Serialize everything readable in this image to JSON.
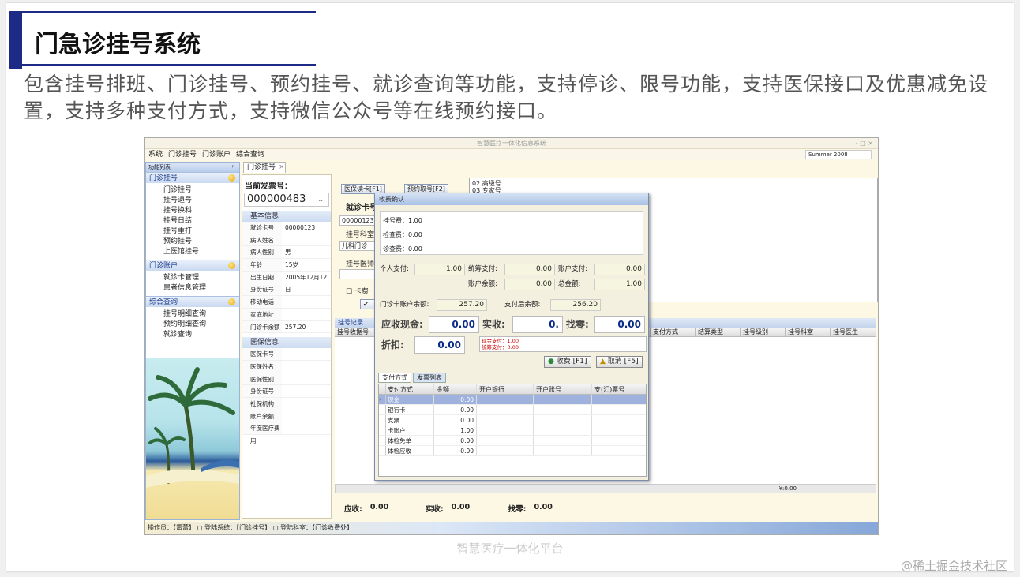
{
  "slide": {
    "title": "门急诊挂号系统",
    "description": "包含挂号排班、门诊挂号、预约挂号、就诊查询等功能，支持停诊、限号功能，支持医保接口及优惠减免设置，支持多种支付方式，支持微信公众号等在线预约接口。",
    "caption": "智慧医疗一体化平台",
    "watermark": "@稀土掘金技术社区"
  },
  "app": {
    "window_title": "智慧医疗一体化信息系统",
    "window_controls": "- □ ×",
    "menu": [
      "系统",
      "门诊挂号",
      "门诊账户",
      "综合查询"
    ],
    "theme": "Summer 2008",
    "function_list_title": "功能列表",
    "pin": "ᵖ",
    "groups": [
      {
        "title": "门诊挂号",
        "items": [
          "门诊挂号",
          "挂号退号",
          "挂号换科",
          "挂号日结",
          "挂号重打",
          "预约挂号",
          "上医馆挂号"
        ]
      },
      {
        "title": "门诊账户",
        "items": [
          "就诊卡管理",
          "患者信息管理"
        ]
      },
      {
        "title": "综合查询",
        "items": [
          "挂号明细查询",
          "预约明细查询",
          "就诊查询"
        ]
      }
    ],
    "tab_label": "门诊挂号",
    "tab_close": "×",
    "invoice_label": "当前发票号：",
    "invoice_no": "000000483",
    "invoice_dots": "...",
    "basic_section": "基本信息",
    "basic_rows": [
      {
        "k": "就诊卡号",
        "v": "00000123"
      },
      {
        "k": "病人姓名",
        "v": ""
      },
      {
        "k": "病人性别",
        "v": "男"
      },
      {
        "k": "年龄",
        "v": "15岁"
      },
      {
        "k": "出生日期",
        "v": "2005年12月12日"
      },
      {
        "k": "身份证号",
        "v": ""
      },
      {
        "k": "移动电话",
        "v": ""
      },
      {
        "k": "家庭地址",
        "v": ""
      },
      {
        "k": "门诊卡余额",
        "v": "257.20"
      }
    ],
    "insurance_section": "医保信息",
    "insurance_rows": [
      {
        "k": "医保卡号",
        "v": ""
      },
      {
        "k": "医保姓名",
        "v": ""
      },
      {
        "k": "医保性别",
        "v": ""
      },
      {
        "k": "身份证号",
        "v": ""
      },
      {
        "k": "社保机构",
        "v": ""
      },
      {
        "k": "账户余额",
        "v": ""
      },
      {
        "k": "年度医疗费用",
        "v": ""
      }
    ],
    "btn_insurance_read": "医保读卡[F1]",
    "btn_reserve": "预约取号[F2]",
    "visit_card_label": "就诊卡号",
    "visit_card_value": "00000123",
    "dept_label": "挂号科室:",
    "dept_value": "儿科门诊",
    "doctor_label": "挂号医师:",
    "card_fee_checkbox": "卡费",
    "reg_types": [
      "02  高级号",
      "03  专家号"
    ],
    "records_title": "挂号记录",
    "records_columns_left": [
      "挂号收据号"
    ],
    "records_columns_right": [
      "支付方式",
      "结算类型",
      "挂号级别",
      "挂号科室",
      "挂号医生"
    ],
    "total_row": "¥:0.00",
    "bottom": {
      "receivable_label": "应收:",
      "receivable": "0.00",
      "paid_label": "实收:",
      "paid": "0.00",
      "change_label": "找零:",
      "change": "0.00"
    },
    "status": "操作员：【雷蕾】 ○ 登陆系统：【门诊挂号】 ○ 登陆科室：【门诊收费处】"
  },
  "dialog": {
    "title": "收费确认",
    "fees": [
      "挂号费：1.00",
      "检查费：0.00",
      "诊查费：0.00"
    ],
    "personal_pay_label": "个人支付:",
    "personal_pay": "1.00",
    "pooled_pay_label": "统筹支付:",
    "pooled_pay": "0.00",
    "account_pay_label": "账户支付:",
    "account_pay": "0.00",
    "account_balance_label": "账户余额:",
    "account_balance": "0.00",
    "total_label": "总金额:",
    "total": "1.00",
    "card_balance_label": "门诊卡账户余额:",
    "card_balance": "257.20",
    "after_pay_balance_label": "支付后余额:",
    "after_pay_balance": "256.20",
    "cash_due_label": "应收现金:",
    "cash_due": "0.00",
    "received_label": "实收:",
    "received": "0.",
    "change_label": "找零:",
    "change": "0.00",
    "discount_label": "折扣:",
    "discount": "0.00",
    "warn_lines": [
      "现金支付：1.00",
      "统筹支付：0.00"
    ],
    "btn_charge": "收费 [F1]",
    "btn_cancel": "取消 [F5]",
    "subtabs": [
      "支付方式",
      "发票列表"
    ],
    "pay_columns": [
      "支付方式",
      "金额",
      "开户银行",
      "开户账号",
      "支(汇)票号"
    ],
    "pay_rows": [
      {
        "method": "现金",
        "amount": "0.00"
      },
      {
        "method": "银行卡",
        "amount": "0.00"
      },
      {
        "method": "支票",
        "amount": "0.00"
      },
      {
        "method": "卡账户",
        "amount": "1.00"
      },
      {
        "method": "体检免单",
        "amount": "0.00"
      },
      {
        "method": "体检应收",
        "amount": "0.00"
      }
    ]
  }
}
